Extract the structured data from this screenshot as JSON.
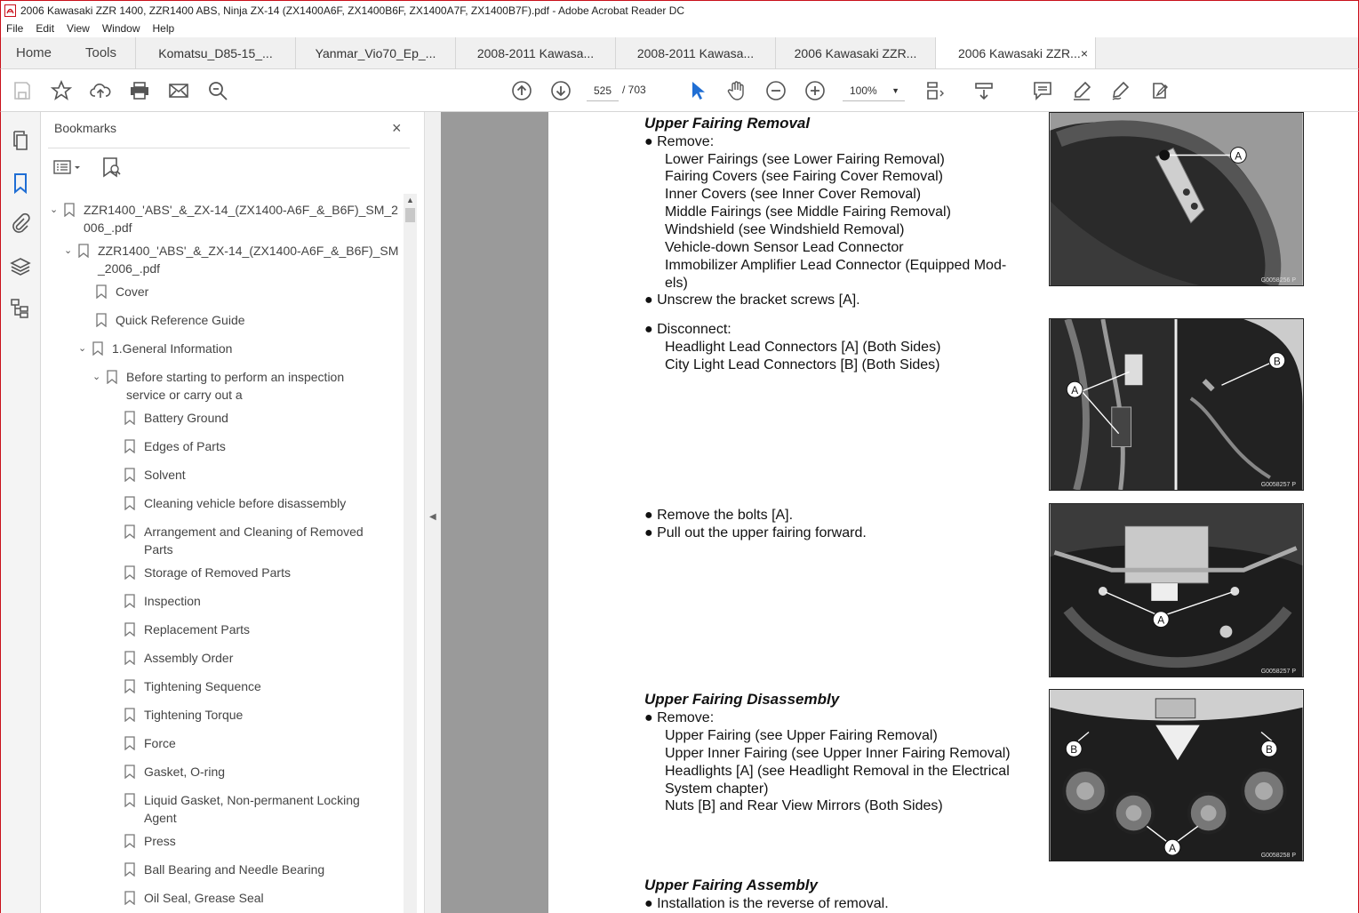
{
  "window": {
    "title": "2006 Kawasaki ZZR 1400, ZZR1400 ABS, Ninja ZX-14 (ZX1400A6F, ZX1400B6F, ZX1400A7F, ZX1400B7F).pdf - Adobe Acrobat Reader DC"
  },
  "menu": [
    "File",
    "Edit",
    "View",
    "Window",
    "Help"
  ],
  "tabs": {
    "home": "Home",
    "tools": "Tools",
    "documents": [
      "Komatsu_D85-15_...",
      "Yanmar_Vio70_Ep_...",
      "2008-2011 Kawasa...",
      "2008-2011 Kawasa...",
      "2006 Kawasaki ZZR...",
      "2006 Kawasaki ZZR..."
    ],
    "active_close": "×"
  },
  "toolbar": {
    "page_current": "525",
    "page_total": "/ 703",
    "zoom": "100%"
  },
  "bookmarks": {
    "header": "Bookmarks",
    "close": "×",
    "items": [
      "ZZR1400_'ABS'_&_ZX-14_(ZX1400-A6F_&_B6F)_SM_2",
      "006_.pdf",
      "ZZR1400_'ABS'_&_ZX-14_(ZX1400-A6F_&_B6F)_SM",
      "_2006_.pdf",
      "Cover",
      "Quick Reference Guide",
      "1.General Information",
      "Before starting to perform an inspection",
      "service or carry out a",
      "Battery Ground",
      "Edges of Parts",
      "Solvent",
      "Cleaning vehicle before disassembly",
      "Arrangement and Cleaning of Removed",
      "Parts",
      "Storage of Removed Parts",
      "Inspection",
      "Replacement Parts",
      "Assembly Order",
      "Tightening Sequence",
      "Tightening Torque",
      "Force",
      "Gasket, O-ring",
      "Liquid Gasket, Non-permanent Locking",
      "Agent",
      "Press",
      "Ball Bearing and Needle Bearing",
      "Oil Seal, Grease Seal"
    ]
  },
  "document": {
    "s1_heading": "Upper Fairing Removal",
    "s1_remove": "● Remove:",
    "s1_items": [
      "Lower Fairings (see Lower Fairing Removal)",
      "Fairing Covers (see Fairing Cover Removal)",
      "Inner Covers (see Inner Cover Removal)",
      "Middle Fairings (see Middle Fairing Removal)",
      "Windshield (see Windshield Removal)",
      "Vehicle-down Sensor Lead Connector",
      "Immobilizer Amplifier Lead Connector (Equipped Mod-",
      "els)"
    ],
    "s1_unscrew": "● Unscrew the bracket screws [A].",
    "s1_disconnect": "● Disconnect:",
    "s1_disconnect_items": [
      "Headlight Lead Connectors [A] (Both Sides)",
      "City Light Lead Connectors [B] (Both Sides)"
    ],
    "s1_bolts": "● Remove the bolts [A].",
    "s1_pull": "● Pull out the upper fairing forward.",
    "s2_heading": "Upper Fairing Disassembly",
    "s2_remove": "● Remove:",
    "s2_items": [
      "Upper Fairing (see Upper Fairing Removal)",
      "Upper Inner Fairing (see Upper Inner Fairing Removal)",
      "Headlights [A] (see Headlight Removal in the Electrical",
      "System chapter)",
      "Nuts [B] and Rear View Mirrors (Both Sides)"
    ],
    "s3_heading": "Upper Fairing Assembly",
    "s3_text": "● Installation is the reverse of removal.",
    "photo_codes": [
      "G0058256  P",
      "G0058257  P",
      "G0058257  P",
      "G0058258  P"
    ],
    "label_a": "A",
    "label_b": "B"
  }
}
